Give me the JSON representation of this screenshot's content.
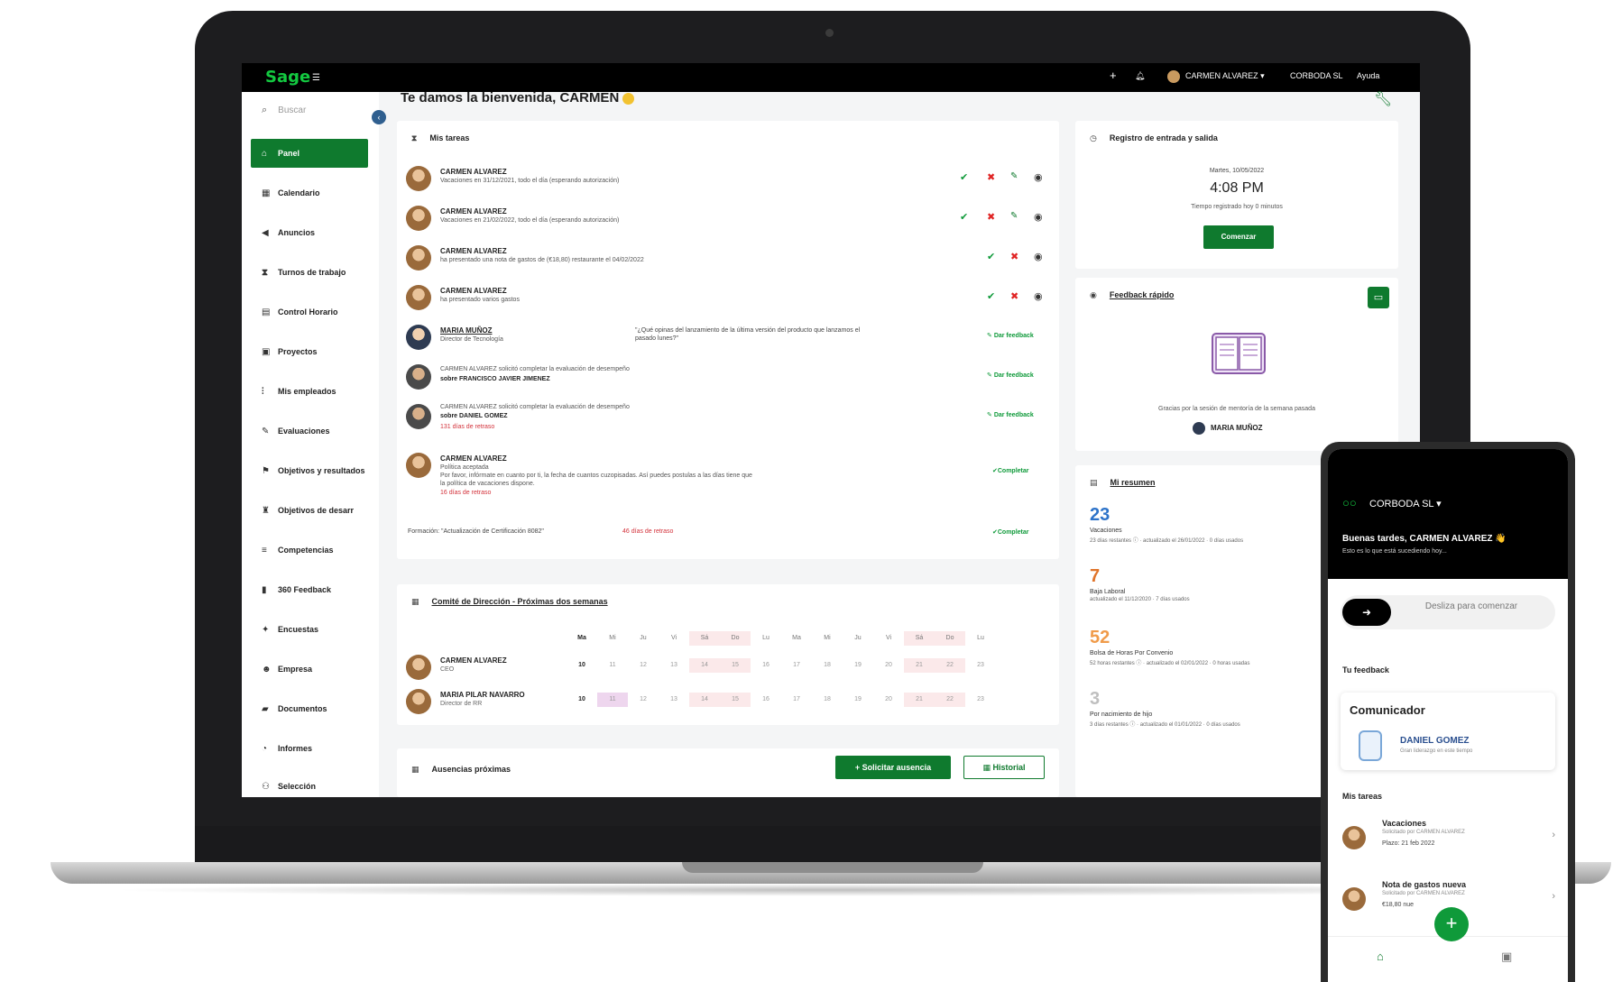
{
  "topbar": {
    "logo": "Sage",
    "user": "CARMEN ALVAREZ ▾",
    "company": "CORBODA SL",
    "help": "Ayuda"
  },
  "sidebar": {
    "search_placeholder": "Buscar",
    "items": [
      {
        "label": "Panel",
        "icon": "home-icon",
        "active": true
      },
      {
        "label": "Calendario",
        "icon": "calendar-icon"
      },
      {
        "label": "Anuncios",
        "icon": "megaphone-icon"
      },
      {
        "label": "Turnos de trabajo",
        "icon": "hourglass-icon"
      },
      {
        "label": "Control Horario",
        "icon": "clock-icon"
      },
      {
        "label": "Proyectos",
        "icon": "briefcase-icon"
      },
      {
        "label": "Mis empleados",
        "icon": "org-chart-icon"
      },
      {
        "label": "Evaluaciones",
        "icon": "chat-icon"
      },
      {
        "label": "Objetivos y resultados",
        "icon": "flag-icon"
      },
      {
        "label": "Objetivos de desarr",
        "icon": "trophy-icon"
      },
      {
        "label": "Competencias",
        "icon": "list-icon"
      },
      {
        "label": "360 Feedback",
        "icon": "document-icon"
      },
      {
        "label": "Encuestas",
        "icon": "survey-icon"
      },
      {
        "label": "Empresa",
        "icon": "users-icon"
      },
      {
        "label": "Documentos",
        "icon": "folder-icon"
      },
      {
        "label": "Informes",
        "icon": "report-icon"
      },
      {
        "label": "Selección",
        "icon": "recruit-icon"
      }
    ]
  },
  "main": {
    "welcome": "Te damos la bienvenida, CARMEN",
    "tasks": {
      "title": "Mis tareas",
      "rows": [
        {
          "name": "CARMEN ALVAREZ",
          "desc": "Vacaciones en 31/12/2021, todo el día (esperando autorización)"
        },
        {
          "name": "CARMEN ALVAREZ",
          "desc": "Vacaciones en 21/02/2022, todo el día (esperando autorización)"
        },
        {
          "name": "CARMEN ALVAREZ",
          "desc": "ha presentado una nota de gastos de (€18,80) restaurante el 04/02/2022"
        },
        {
          "name": "CARMEN ALVAREZ",
          "desc": "ha presentado varios gastos"
        },
        {
          "name": "MARIA MUÑOZ",
          "desc": "Director de Tecnología",
          "quote": "\"¿Qué opinas del lanzamiento de la última versión del producto que lanzamos el pasado lunes?\"",
          "action": "Dar feedback"
        },
        {
          "name": "CARMEN ALVAREZ solicitó completar la evaluación de desempeño",
          "desc": "sobre FRANCISCO JAVIER JIMENEZ",
          "action": "Dar feedback"
        },
        {
          "name": "CARMEN ALVAREZ solicitó completar la evaluación de desempeño",
          "desc": "sobre DANIEL GOMEZ",
          "red": "131 días de retraso",
          "action": "Dar feedback"
        },
        {
          "name": "CARMEN ALVAREZ",
          "desc": "Política aceptada",
          "desc2": "Por favor, infórmate en cuanto por ti, la fecha de cuantos cuzopisadas. Así puedes postulas a las días tiene que",
          "desc3": "la política de vacaciones dispone.",
          "red": "16 días de retraso",
          "action": "Completar"
        }
      ],
      "formation": "Formación: \"Actualización de Certificación 8082\"",
      "formation_delay": "46 días de retraso",
      "formation_action": "Completar",
      "actions": {
        "check": "✔",
        "cross": "✖",
        "pen": "✎",
        "eye": "◉"
      }
    },
    "committee": {
      "title": "Comité de Dirección - Próximas dos semanas",
      "days": [
        "Ma",
        "Mi",
        "Ju",
        "Vi",
        "Sá",
        "Do",
        "Lu",
        "Ma",
        "Mi",
        "Ju",
        "Vi",
        "Sá",
        "Do",
        "Lu"
      ],
      "people": [
        {
          "name": "CARMEN ALVAREZ",
          "role": "CEO",
          "dates": [
            "10",
            "11",
            "12",
            "13",
            "14",
            "15",
            "16",
            "17",
            "18",
            "19",
            "20",
            "21",
            "22",
            "23"
          ]
        },
        {
          "name": "MARIA PILAR NAVARRO",
          "role": "Director de RR",
          "dates": [
            "10",
            "11",
            "12",
            "13",
            "14",
            "15",
            "16",
            "17",
            "18",
            "19",
            "20",
            "21",
            "22",
            "23"
          ]
        }
      ]
    },
    "absences": {
      "title": "Ausencias próximas",
      "request": "Solicitar ausencia",
      "history": "Historial"
    },
    "clock": {
      "title": "Registro de entrada y salida",
      "date": "Martes, 10/05/2022",
      "time": "4:08 PM",
      "note": "Tiempo registrado hoy 0 minutos",
      "button": "Comenzar"
    },
    "feedback": {
      "title": "Feedback rápido",
      "thanks": "Gracias por la sesión de mentoría de la semana pasada",
      "person": "MARIA MUÑOZ"
    },
    "summary": {
      "title": "Mi resumen",
      "stats": [
        {
          "value": "23",
          "label": "Vacaciones",
          "meta": "23 días restantes ⓘ · actualizado el 26/01/2022 · 0 días usados",
          "color": "#2d73c9"
        },
        {
          "value": "7",
          "label": "Baja Laboral",
          "meta": "actualizado el 11/12/2020 · 7 días usados",
          "color": "#e0742a"
        },
        {
          "value": "52",
          "label": "Bolsa de Horas Por Convenio",
          "meta": "52 horas restantes ⓘ · actualizado el 02/01/2022 · 0 horas usadas",
          "color": "#f09b4a"
        },
        {
          "value": "3",
          "label": "Por nacimiento de hijo",
          "meta": "3 días restantes ⓘ · actualizado el 01/01/2022 · 0 días usados",
          "color": "#bfbfbf"
        }
      ]
    }
  },
  "phone": {
    "company": "CORBODA SL ▾",
    "greeting": "Buenas tardes, CARMEN ALVAREZ 👋",
    "sub": "Esto es lo que está sucediendo hoy...",
    "slide": "Desliza para comenzar",
    "feedback_section": "Tu feedback",
    "card_title": "Comunicador",
    "card_name": "DANIEL GOMEZ",
    "card_sub": "Gran liderazgo en este tiempo",
    "tasks_section": "Mis tareas",
    "tasks": [
      {
        "title": "Vacaciones",
        "sub": "Solicitado por CARMEN ALVAREZ",
        "sub2": "Plazo: 21 feb 2022"
      },
      {
        "title": "Nota de gastos nueva",
        "sub": "Solicitado por CARMEN ALVAREZ",
        "sub2": "€18,80 nue"
      }
    ]
  }
}
